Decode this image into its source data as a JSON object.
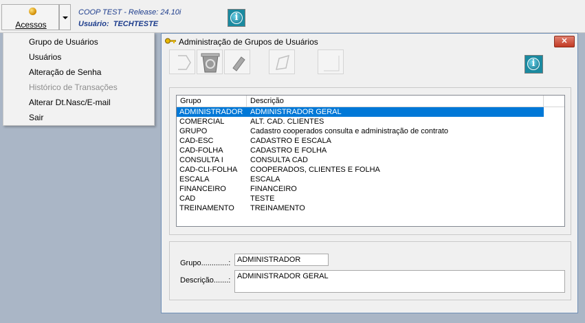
{
  "toolbar": {
    "acessos_label": "Acessos",
    "app_title": "COOP TEST - Release: 24.10i",
    "user_label": "Usuário:",
    "user_name": "TECHTESTE",
    "info_icon": "info-icon"
  },
  "menu": {
    "items": [
      {
        "label": "Grupo de Usuários",
        "enabled": true
      },
      {
        "label": "Usuários",
        "enabled": true
      },
      {
        "label": "Alteração de Senha",
        "enabled": true
      },
      {
        "label": "Histórico de Transações",
        "enabled": false
      },
      {
        "label": "Alterar Dt.Nasc/E-mail",
        "enabled": true
      },
      {
        "label": "Sair",
        "enabled": true
      }
    ]
  },
  "window": {
    "title": "Administração de Grupos de Usuários",
    "close_label": "✕",
    "toolbar_icons": [
      "new-icon",
      "recycle-bin-icon",
      "eraser-icon",
      "edit-icon",
      "blank-icon"
    ],
    "list": {
      "columns": [
        "Grupo",
        "Descrição"
      ],
      "rows": [
        {
          "grupo": "ADMINISTRADOR",
          "descricao": "ADMINISTRADOR GERAL",
          "selected": true
        },
        {
          "grupo": "COMERCIAL",
          "descricao": "ALT. CAD. CLIENTES"
        },
        {
          "grupo": "GRUPO",
          "descricao": "Cadastro cooperados consulta e administração de contrato"
        },
        {
          "grupo": "CAD-ESC",
          "descricao": "CADASTRO E ESCALA"
        },
        {
          "grupo": "CAD-FOLHA",
          "descricao": "CADASTRO E FOLHA"
        },
        {
          "grupo": "CONSULTA I",
          "descricao": "CONSULTA CAD"
        },
        {
          "grupo": "CAD-CLI-FOLHA",
          "descricao": "COOPERADOS, CLIENTES E FOLHA"
        },
        {
          "grupo": "ESCALA",
          "descricao": "ESCALA"
        },
        {
          "grupo": "FINANCEIRO",
          "descricao": "FINANCEIRO"
        },
        {
          "grupo": "CAD",
          "descricao": "TESTE"
        },
        {
          "grupo": "TREINAMENTO",
          "descricao": "TREINAMENTO"
        }
      ]
    },
    "form": {
      "grupo_label": "Grupo.............:",
      "grupo_value": "ADMINISTRADOR",
      "descricao_label": "Descrição.......:",
      "descricao_value": "ADMINISTRADOR GERAL"
    }
  },
  "colors": {
    "desktop": "#aab6c6",
    "selection": "#0078d7",
    "title_text": "#1c3c8c",
    "close_button": "#c23a24"
  }
}
